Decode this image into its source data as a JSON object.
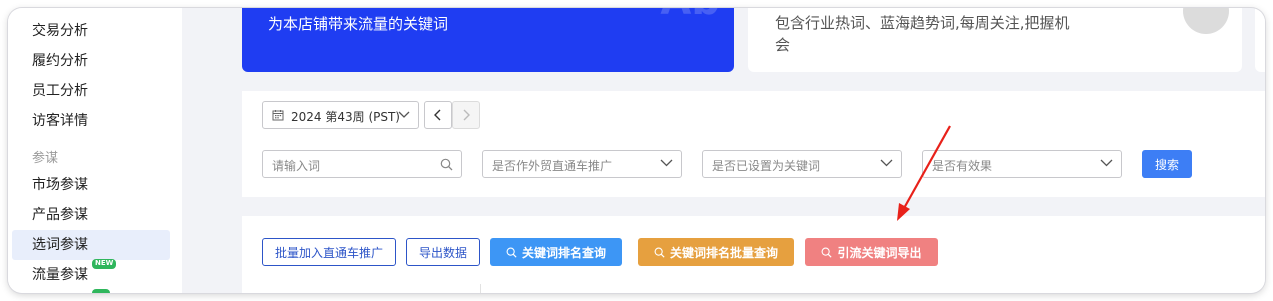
{
  "sidebar": {
    "items": [
      {
        "label": "交易分析"
      },
      {
        "label": "履约分析"
      },
      {
        "label": "员工分析"
      },
      {
        "label": "访客详情"
      }
    ],
    "group_label": "参谋",
    "group_items": [
      {
        "label": "市场参谋"
      },
      {
        "label": "产品参谋"
      },
      {
        "label": "选词参谋"
      },
      {
        "label": "流量参谋"
      }
    ],
    "new_badge": "NEW",
    "active_item": "选词参谋"
  },
  "cards": {
    "blue_text": "为本店铺带来流量的关键词",
    "blue_watermark": "Ab",
    "white_text": "包含行业热词、蓝海趋势词,每周关注,把握机会"
  },
  "filters": {
    "week_value": "2024 第43周 (PST)",
    "keyword_placeholder": "请输入词",
    "select1": "是否作外贸直通车推广",
    "select2": "是否已设置为关键词",
    "select3": "是否有效果",
    "search_label": "搜索"
  },
  "actions": {
    "batch_add": "批量加入直通车推广",
    "export": "导出数据",
    "rank_query": "关键词排名查询",
    "rank_batch_query": "关键词排名批量查询",
    "export_traffic": "引流关键词导出"
  },
  "colors": {
    "accent_blue": "#3d7ef5",
    "card_blue": "#1f3df2",
    "orange": "#e6a03f",
    "pink": "#f08181",
    "arrow_red": "#e8211a",
    "new_badge": "#2fb65c"
  },
  "icons": {
    "calendar": "calendar-icon",
    "chevron_down": "chevron-down-icon",
    "chevron_left": "chevron-left-icon",
    "chevron_right": "chevron-right-icon",
    "search": "search-icon"
  }
}
